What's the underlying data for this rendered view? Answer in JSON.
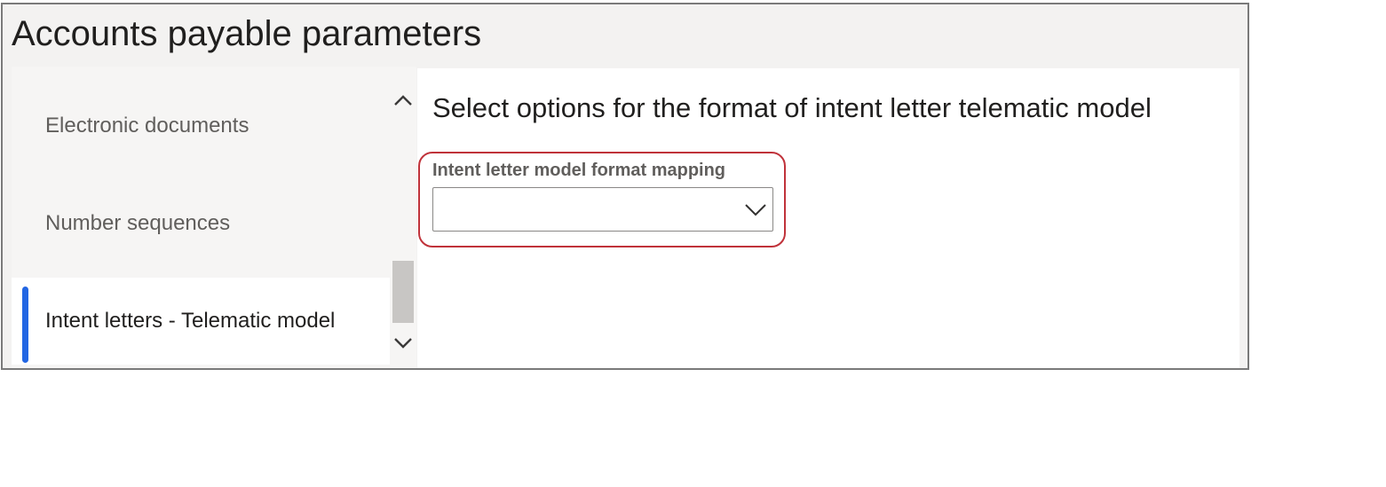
{
  "page": {
    "title": "Accounts payable parameters"
  },
  "sidebar": {
    "items": [
      {
        "label": "Electronic documents",
        "selected": false
      },
      {
        "label": "Number sequences",
        "selected": false
      },
      {
        "label": "Intent letters - Telematic model",
        "selected": true
      }
    ]
  },
  "scrollbar": {
    "up_icon": "chevron-up-icon",
    "down_icon": "chevron-down-icon"
  },
  "main": {
    "section_title": "Select options for the format of intent letter telematic model",
    "field": {
      "label": "Intent letter model format mapping",
      "value": "",
      "icon": "chevron-down-icon"
    }
  },
  "colors": {
    "accent": "#2266e3",
    "highlight_border": "#c0323a",
    "background": "#f3f2f1"
  }
}
